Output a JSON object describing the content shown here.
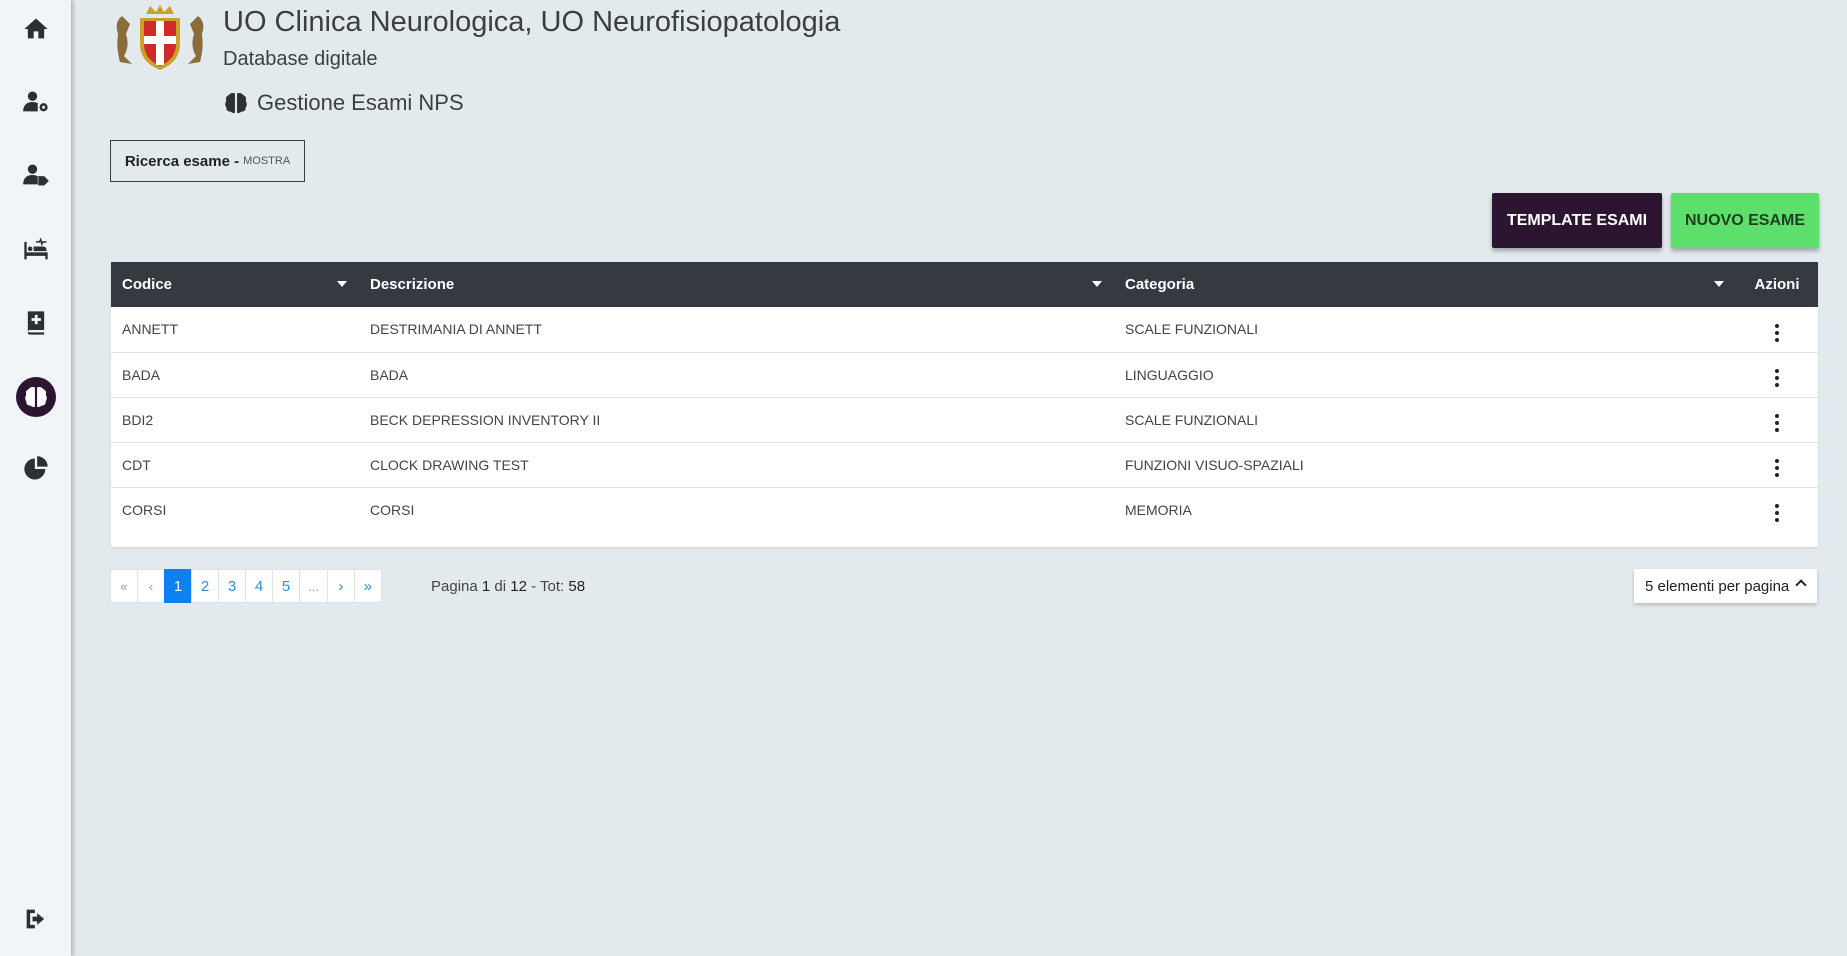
{
  "header": {
    "title": "UO Clinica Neurologica, UO Neurofisiopatologia",
    "subtitle": "Database digitale",
    "section_title": "Gestione Esami NPS"
  },
  "sidebar": {
    "items": [
      {
        "icon": "home-icon"
      },
      {
        "icon": "user-gear-icon"
      },
      {
        "icon": "user-tag-icon"
      },
      {
        "icon": "bed-pulse-icon"
      },
      {
        "icon": "book-medical-icon"
      },
      {
        "icon": "brain-icon",
        "active": true
      },
      {
        "icon": "chart-pie-icon"
      }
    ],
    "logout_icon": "logout-icon"
  },
  "search_toggle": {
    "label": "Ricerca esame -",
    "action": "MOSTRA"
  },
  "toolbar": {
    "template_label": "TEMPLATE ESAMI",
    "new_label": "NUOVO ESAME"
  },
  "table": {
    "columns": [
      "Codice",
      "Descrizione",
      "Categoria",
      "Azioni"
    ],
    "rows": [
      {
        "codice": "ANNETT",
        "descrizione": "DESTRIMANIA DI ANNETT",
        "categoria": "SCALE FUNZIONALI"
      },
      {
        "codice": "BADA",
        "descrizione": "BADA",
        "categoria": "LINGUAGGIO"
      },
      {
        "codice": "BDI2",
        "descrizione": "BECK DEPRESSION INVENTORY II",
        "categoria": "SCALE FUNZIONALI"
      },
      {
        "codice": "CDT",
        "descrizione": "CLOCK DRAWING TEST",
        "categoria": "FUNZIONI VISUO-SPAZIALI"
      },
      {
        "codice": "CORSI",
        "descrizione": "CORSI",
        "categoria": "MEMORIA"
      }
    ]
  },
  "pagination": {
    "first": "«",
    "prev": "‹",
    "pages": [
      "1",
      "2",
      "3",
      "4",
      "5"
    ],
    "ellipsis": "...",
    "next": "›",
    "last": "»",
    "current": "1",
    "info_prefix": "Pagina",
    "info_page": "1",
    "info_of": "di",
    "info_total_pages": "12",
    "info_tot_label": "- Tot:",
    "info_total": "58",
    "per_page": "5 elementi per pagina"
  },
  "colors": {
    "accent_dark": "#2b1530",
    "accent_green": "#5de06b",
    "table_header": "#343a40",
    "page_active": "#0d80f2",
    "background": "#e3eaed"
  }
}
